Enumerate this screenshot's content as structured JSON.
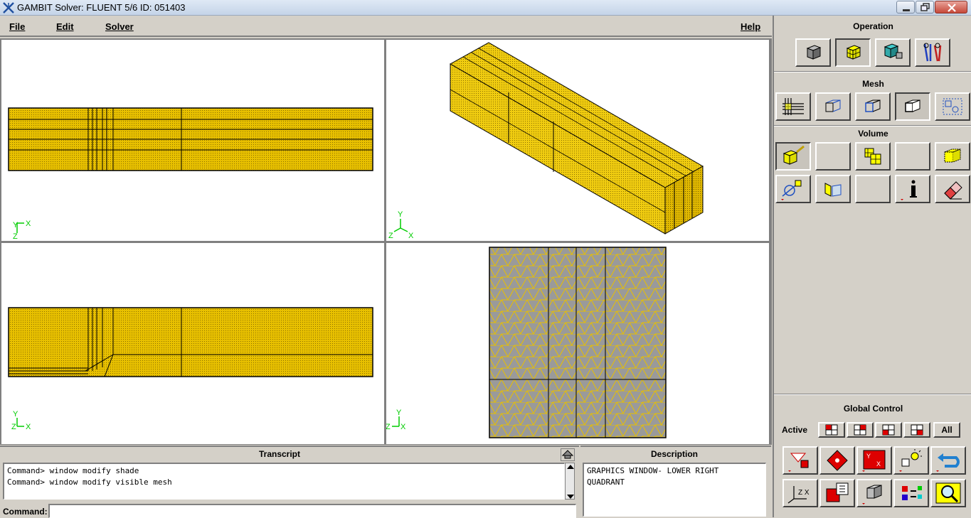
{
  "titlebar": {
    "title": "GAMBIT    Solver: FLUENT 5/6    ID: 051403"
  },
  "menu": {
    "file": "File",
    "edit": "Edit",
    "solver": "Solver",
    "help": "Help"
  },
  "axes": {
    "y": "Y",
    "x": "X",
    "z": "Z"
  },
  "panel": {
    "operation_label": "Operation",
    "mesh_label": "Mesh",
    "volume_label": "Volume",
    "global_label": "Global Control",
    "active_label": "Active",
    "all_label": "All"
  },
  "transcript": {
    "header": "Transcript",
    "lines": [
      "Command> window modify shade",
      "Command> window modify visible mesh"
    ],
    "command_label": "Command:",
    "command_value": ""
  },
  "description": {
    "header": "Description",
    "text_line1": "GRAPHICS WINDOW- LOWER RIGHT",
    "text_line2": "QUADRANT"
  },
  "colors": {
    "mesh_fill": "#e8c000",
    "mesh_line": "#c8a400",
    "axis_green": "#00cc00"
  }
}
